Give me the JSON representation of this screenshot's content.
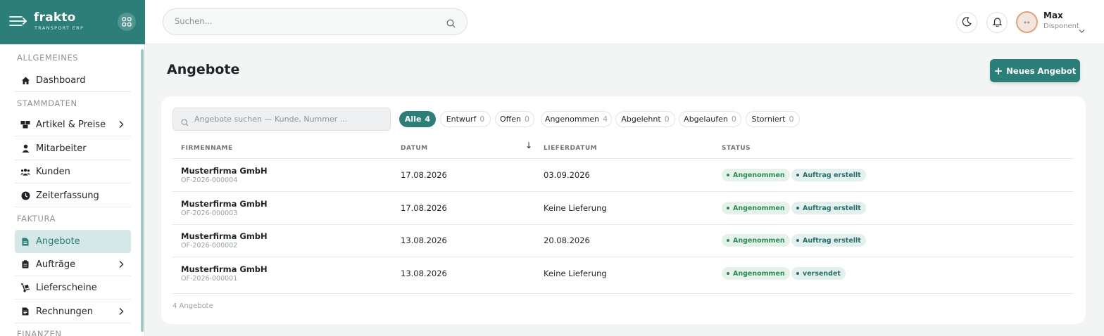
{
  "brand": {
    "name": "frakto",
    "tagline": "TRANSPORT ERP"
  },
  "icons": {
    "menu": "menu-arrow-icon",
    "apps": "apps-grid-icon",
    "search": "search-icon",
    "theme": "moon-icon",
    "notifications": "bell-icon",
    "avatar": "avatar"
  },
  "colors": {
    "accent": "#2b7f78",
    "accent_light": "#d4e9e7",
    "status_green": "#2e8a57"
  },
  "topbar": {
    "search_placeholder": "Suchen...",
    "user": {
      "name": "Max",
      "role": "Disponent"
    }
  },
  "sidebar": {
    "sections": [
      {
        "label": "ALLGEMEINES"
      },
      {
        "label": "STAMMDATEN"
      },
      {
        "label": "FAKTURA"
      },
      {
        "label": "FINANZEN"
      }
    ],
    "items": [
      {
        "label": "Dashboard",
        "icon": "home-icon",
        "has_submenu": false,
        "active": false
      },
      {
        "label": "Artikel & Preise",
        "icon": "boxes-icon",
        "has_submenu": true,
        "active": false
      },
      {
        "label": "Mitarbeiter",
        "icon": "person-icon",
        "has_submenu": false,
        "active": false
      },
      {
        "label": "Kunden",
        "icon": "people-icon",
        "has_submenu": false,
        "active": false
      },
      {
        "label": "Zeiterfassung",
        "icon": "clock-icon",
        "has_submenu": false,
        "active": false
      },
      {
        "label": "Angebote",
        "icon": "document-icon",
        "has_submenu": false,
        "active": true
      },
      {
        "label": "Aufträge",
        "icon": "clipboard-icon",
        "has_submenu": true,
        "active": false
      },
      {
        "label": "Lieferscheine",
        "icon": "dolly-icon",
        "has_submenu": false,
        "active": false
      },
      {
        "label": "Rechnungen",
        "icon": "invoice-icon",
        "has_submenu": true,
        "active": false
      }
    ]
  },
  "page": {
    "title": "Angebote",
    "new_button": "Neues Angebot",
    "new_button_icon": "+"
  },
  "filters": {
    "search_placeholder": "Angebote suchen — Kunde, Nummer ...",
    "pills": [
      {
        "label": "Alle",
        "count": "4",
        "active": true
      },
      {
        "label": "Entwurf",
        "count": "0",
        "active": false
      },
      {
        "label": "Offen",
        "count": "0",
        "active": false
      },
      {
        "label": "Angenommen",
        "count": "4",
        "active": false
      },
      {
        "label": "Abgelehnt",
        "count": "0",
        "active": false
      },
      {
        "label": "Abgelaufen",
        "count": "0",
        "active": false
      },
      {
        "label": "Storniert",
        "count": "0",
        "active": false
      }
    ]
  },
  "table": {
    "columns": [
      "FIRMENNAME",
      "DATUM",
      "LIEFERDATUM",
      "STATUS"
    ],
    "sort_indicator": "↓",
    "rows": [
      {
        "firm": "Musterfirma GmbH",
        "number": "OF-2026-000004",
        "date": "17.08.2026",
        "delivery": "03.09.2026",
        "status": "Angenommen",
        "sub_status": "Auftrag erstellt"
      },
      {
        "firm": "Musterfirma GmbH",
        "number": "OF-2026-000003",
        "date": "17.08.2026",
        "delivery": "Keine Lieferung",
        "status": "Angenommen",
        "sub_status": "Auftrag erstellt"
      },
      {
        "firm": "Musterfirma GmbH",
        "number": "OF-2026-000002",
        "date": "13.08.2026",
        "delivery": "20.08.2026",
        "status": "Angenommen",
        "sub_status": "Auftrag erstellt"
      },
      {
        "firm": "Musterfirma GmbH",
        "number": "OF-2026-000001",
        "date": "13.08.2026",
        "delivery": "Keine Lieferung",
        "status": "Angenommen",
        "sub_status": "versendet"
      }
    ],
    "footer": "4 Angebote"
  }
}
